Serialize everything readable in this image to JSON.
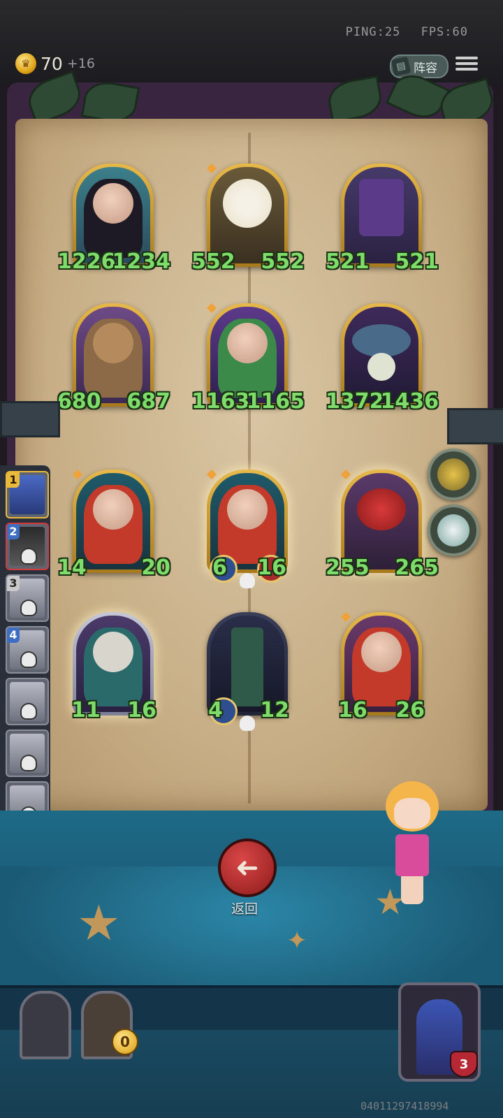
{
  "status": {
    "ping": "PING:25",
    "fps": "FPS:60"
  },
  "currency": {
    "icon": "crown-coin-icon",
    "gold": "70",
    "income": "+16"
  },
  "header": {
    "lineup_label": "阵容",
    "lineup_icon": "book-icon",
    "menu_icon": "menu-icon"
  },
  "board": {
    "cards": [
      {
        "attack": "1226",
        "health": "1234"
      },
      {
        "attack": "552",
        "health": "552"
      },
      {
        "attack": "521",
        "health": "521"
      },
      {
        "attack": "680",
        "health": "687"
      },
      {
        "attack": "1163",
        "health": "1165"
      },
      {
        "attack": "1372",
        "health": "1436"
      },
      {
        "attack": "14",
        "health": "20"
      },
      {
        "attack": "6",
        "health": "16"
      },
      {
        "attack": "255",
        "health": "265"
      },
      {
        "attack": "11",
        "health": "16"
      },
      {
        "attack": "4",
        "health": "12"
      },
      {
        "attack": "16",
        "health": "26"
      }
    ]
  },
  "side_buttons": [
    {
      "icon": "golden-bird-icon"
    },
    {
      "icon": "ghost-monster-icon"
    }
  ],
  "opponents": [
    {
      "rank": "1"
    },
    {
      "rank": "2"
    },
    {
      "rank": "3"
    },
    {
      "rank": "4"
    },
    {
      "rank": ""
    },
    {
      "rank": ""
    },
    {
      "rank": ""
    },
    {
      "rank": ""
    }
  ],
  "back_button": {
    "label": "返回",
    "icon": "arrow-left-icon"
  },
  "shop": {
    "coins": "0"
  },
  "hero": {
    "health": "3"
  },
  "footer": {
    "player_id": "04011297418994"
  }
}
